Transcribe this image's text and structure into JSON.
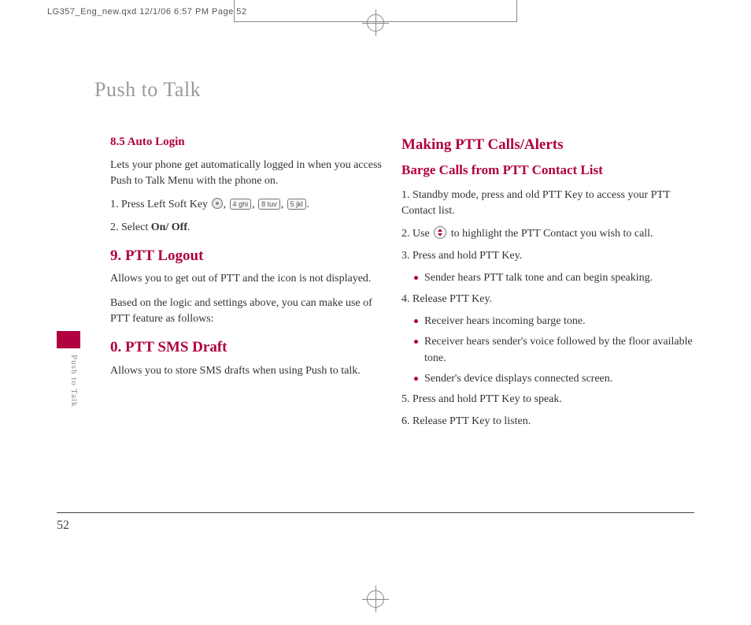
{
  "print_header": "LG357_Eng_new.qxd  12/1/06  6:57 PM  Page 52",
  "page_title": "Push to Talk",
  "sidebar_label": "Push to Talk",
  "page_number": "52",
  "left": {
    "h1": "8.5 Auto Login",
    "p1": "Lets your phone get automatically logged in when you access Push to Talk Menu with the phone on.",
    "step1_prefix": "1. Press Left Soft Key ",
    "key1": "4 ghi",
    "key2": "8 tuv",
    "key3": "5 jkl",
    "step2_prefix": "2. Select ",
    "step2_bold": "On/ Off",
    "h2": "9. PTT Logout",
    "p2": "Allows you to get out of PTT and the icon is not displayed.",
    "p3": "Based on the logic and settings above, you can make use of PTT feature as follows:",
    "h3": "0. PTT SMS Draft",
    "p4": "Allows you to store SMS drafts when using Push to talk."
  },
  "right": {
    "h1": "Making PTT Calls/Alerts",
    "h2": "Barge Calls from PTT Contact List",
    "s1": "1. Standby mode, press and old PTT Key to access your PTT Contact list.",
    "s2a": "2. Use ",
    "s2b": " to highlight the PTT Contact you wish to call.",
    "s3": "3. Press and hold PTT Key.",
    "b3a": "Sender hears PTT talk tone and can begin speaking.",
    "s4": "4. Release PTT Key.",
    "b4a": "Receiver hears incoming barge tone.",
    "b4b": "Receiver hears sender's voice followed by the floor available tone.",
    "b4c": "Sender's device displays connected screen.",
    "s5": "5. Press and hold PTT Key to speak.",
    "s6": "6. Release PTT Key to listen."
  }
}
